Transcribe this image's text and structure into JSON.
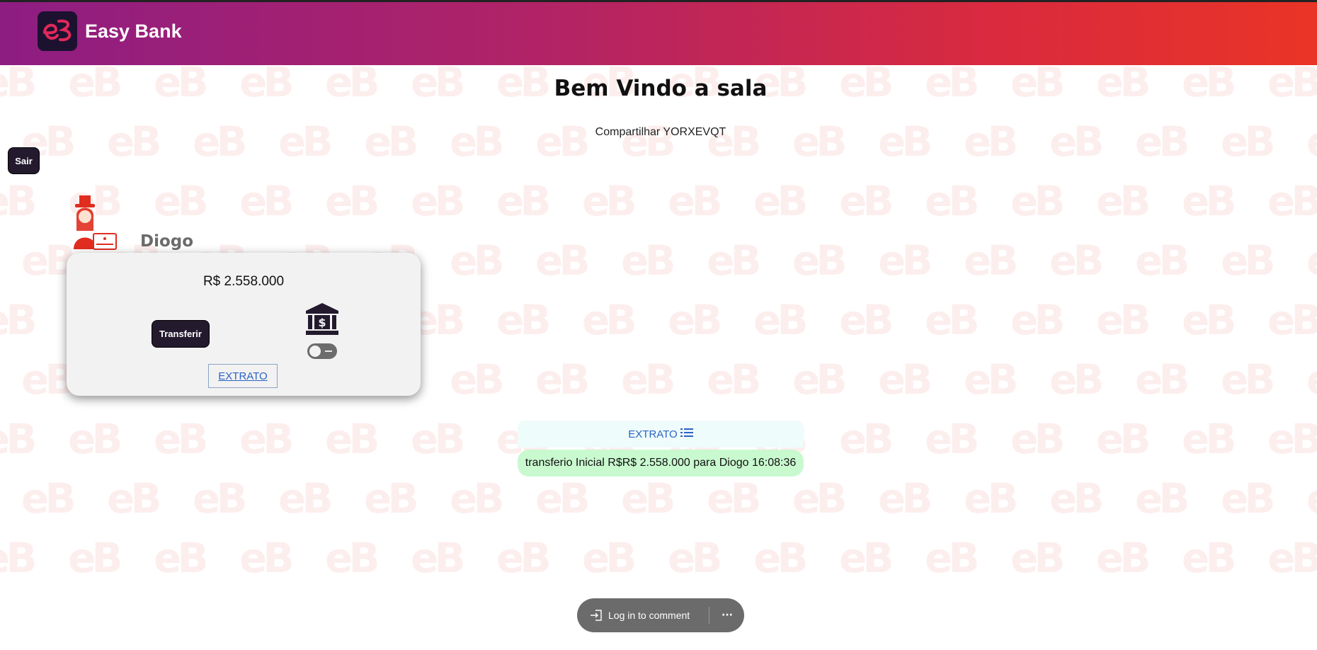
{
  "header": {
    "app_name": "Easy Bank",
    "logo_icon": "eb-logo-icon",
    "gradient_start": "#8e1d82",
    "gradient_end": "#ea3426"
  },
  "room": {
    "title": "Bem Vindo a sala",
    "share_text": "Compartilhar YORXEVQT",
    "exit_label": "Sair"
  },
  "player": {
    "name": "Diogo",
    "avatar_icon": "banker-avatar-icon",
    "balance": "R$ 2.558.000",
    "transfer_label": "Transferir",
    "bank_icon": "bank-icon",
    "toggle_on": false,
    "statement_link": "EXTRATO"
  },
  "ledger": {
    "header_label": "EXTRATO",
    "header_icon": "list-icon",
    "entries": [
      "transferio Inicial R$R$ 2.558.000 para Diogo 16:08:36"
    ]
  },
  "comment_bar": {
    "login_label": "Log in to comment",
    "more_label": "···"
  }
}
